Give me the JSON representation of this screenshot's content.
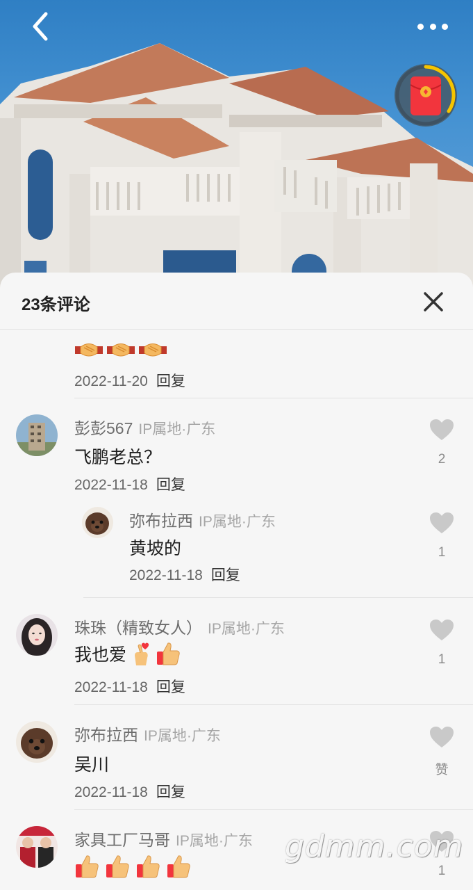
{
  "header": {
    "title": "23条评论"
  },
  "icons": {
    "back": "chevron-left-icon",
    "more": "more-dots-icon",
    "redpack": "red-envelope-icon",
    "close": "close-icon",
    "like": "heart-icon"
  },
  "colors": {
    "accent_red": "#f2353d",
    "redpack_ring": "#f6c500",
    "like_grey": "#c9c9c9"
  },
  "comments": {
    "c0": {
      "date": "2022-11-20",
      "reply": "回复"
    },
    "c1": {
      "name": "彭彭567",
      "ip": "IP属地·广东",
      "text": "飞鹏老总？",
      "date": "2022-11-18",
      "reply": "回复",
      "likes": "2",
      "sub": {
        "name": "弥布拉西",
        "ip": "IP属地·广东",
        "text": "黄坡的",
        "date": "2022-11-18",
        "reply": "回复",
        "likes": "1"
      }
    },
    "c2": {
      "name": "珠珠（精致女人）",
      "ip": "IP属地·广东",
      "text": "我也爱",
      "date": "2022-11-18",
      "reply": "回复",
      "likes": "1"
    },
    "c3": {
      "name": "弥布拉西",
      "ip": "IP属地·广东",
      "text": "吴川",
      "date": "2022-11-18",
      "reply": "回复",
      "likes": "赞"
    },
    "c4": {
      "name": "家具工厂马哥",
      "ip": "IP属地·广东",
      "likes": "1"
    }
  },
  "watermark": "gdmm.com"
}
